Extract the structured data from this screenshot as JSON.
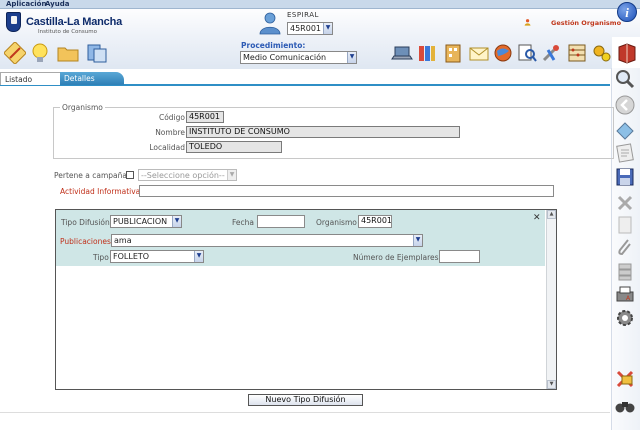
{
  "menu": {
    "aplicacion": "Aplicación",
    "ayuda": "Ayuda"
  },
  "header": {
    "logo_title": "Castilla-La Mancha",
    "logo_subtitle": "Instituto de Consumo",
    "espiral_label": "ESPIRAL",
    "espiral_value": "45R001",
    "gestion_label": "Gestión Organismo",
    "info_icon": "i"
  },
  "toolbar": {
    "procedimiento_label": "Procedimiento:",
    "procedimiento_value": "Medio Comunicación"
  },
  "tabs": {
    "listado": "Listado",
    "detalles": "Detalles"
  },
  "organismo": {
    "legend": "Organismo",
    "codigo_label": "Código",
    "codigo_value": "45R001",
    "nombre_label": "Nombre",
    "nombre_value": "INSTITUTO DE CONSUMO",
    "localidad_label": "Localidad",
    "localidad_value": "TOLEDO"
  },
  "campana": {
    "label": "Pertene a campaña",
    "checked": false,
    "select_placeholder": "--Seleccione opción--"
  },
  "actividad": {
    "label": "Actividad Informativa",
    "value": ""
  },
  "difusion": {
    "tipo_difusion_label": "Tipo Difusión",
    "tipo_difusion_value": "PUBLICACION",
    "fecha_label": "Fecha",
    "fecha_value": "",
    "organismo_label": "Organismo",
    "organismo_value": "45R001",
    "publicaciones_label": "Publicaciones",
    "publicaciones_value": "ama",
    "tipo_label": "Tipo",
    "tipo_value": "FOLLETO",
    "ejemplares_label": "Número de Ejemplares",
    "ejemplares_value": ""
  },
  "buttons": {
    "nuevo_tipo_difusion": "Nuevo Tipo Difusión"
  },
  "colors": {
    "accent": "#2f8fc6",
    "required_label": "#c0301a",
    "panel_bg": "#cfe6e6"
  }
}
